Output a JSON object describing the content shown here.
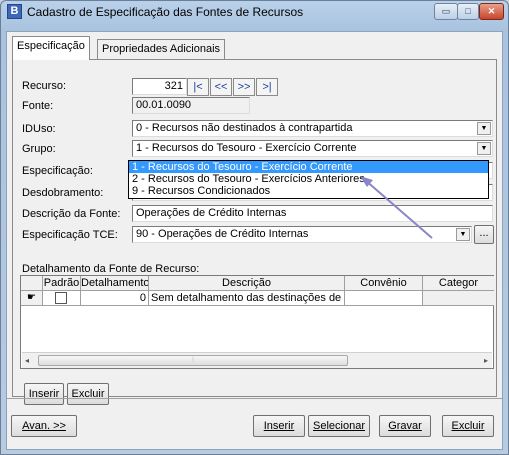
{
  "window": {
    "title": "Cadastro de Especificação das Fontes de Recursos",
    "icon_letter": "B",
    "minimize": "▭",
    "maximize": "□",
    "close": "✕"
  },
  "tabs": [
    {
      "label": "Especificação"
    },
    {
      "label": "Propriedades Adicionais"
    }
  ],
  "form": {
    "recurso": {
      "label": "Recurso:",
      "value": "321",
      "nav": [
        "|<",
        "<<",
        ">>",
        ">|"
      ]
    },
    "fonte": {
      "label": "Fonte:",
      "value": "00.01.0090"
    },
    "iduso": {
      "label": "IDUso:",
      "value": "0 - Recursos não destinados à contrapartida"
    },
    "grupo": {
      "label": "Grupo:",
      "value": "1 - Recursos do Tesouro - Exercício Corrente"
    },
    "especificacao": {
      "label": "Especificação:"
    },
    "desdobramento": {
      "label": "Desdobramento:"
    },
    "descricao_fonte": {
      "label": "Descrição da Fonte:",
      "value": "Operações de Crédito Internas"
    },
    "especificacao_tce": {
      "label": "Especificação TCE:",
      "value": "90 - Operações de Crédito Internas",
      "ellipsis": "..."
    }
  },
  "dropdown": {
    "options": [
      "1 - Recursos do Tesouro - Exercício Corrente",
      "2 - Recursos do Tesouro - Exercícios Anteriores",
      "9 - Recursos Condicionados"
    ],
    "selected_index": 0
  },
  "grid": {
    "title": "Detalhamento da Fonte de Recurso:",
    "columns": [
      "Padrão",
      "Detalhamento",
      "Descrição",
      "Convênio",
      "Categor"
    ],
    "rows": [
      {
        "detalhamento": "0",
        "descricao": "Sem detalhamento das destinações de re"
      }
    ]
  },
  "grid_buttons": {
    "inserir": "Inserir",
    "excluir": "Excluir"
  },
  "footer": {
    "avan": "Avan. >>",
    "inserir": "Inserir",
    "selecionar": "Selecionar",
    "gravar": "Gravar",
    "excluir": "Excluir"
  },
  "colors": {
    "selection": "#3399ff",
    "arrow": "#8a85c9"
  }
}
